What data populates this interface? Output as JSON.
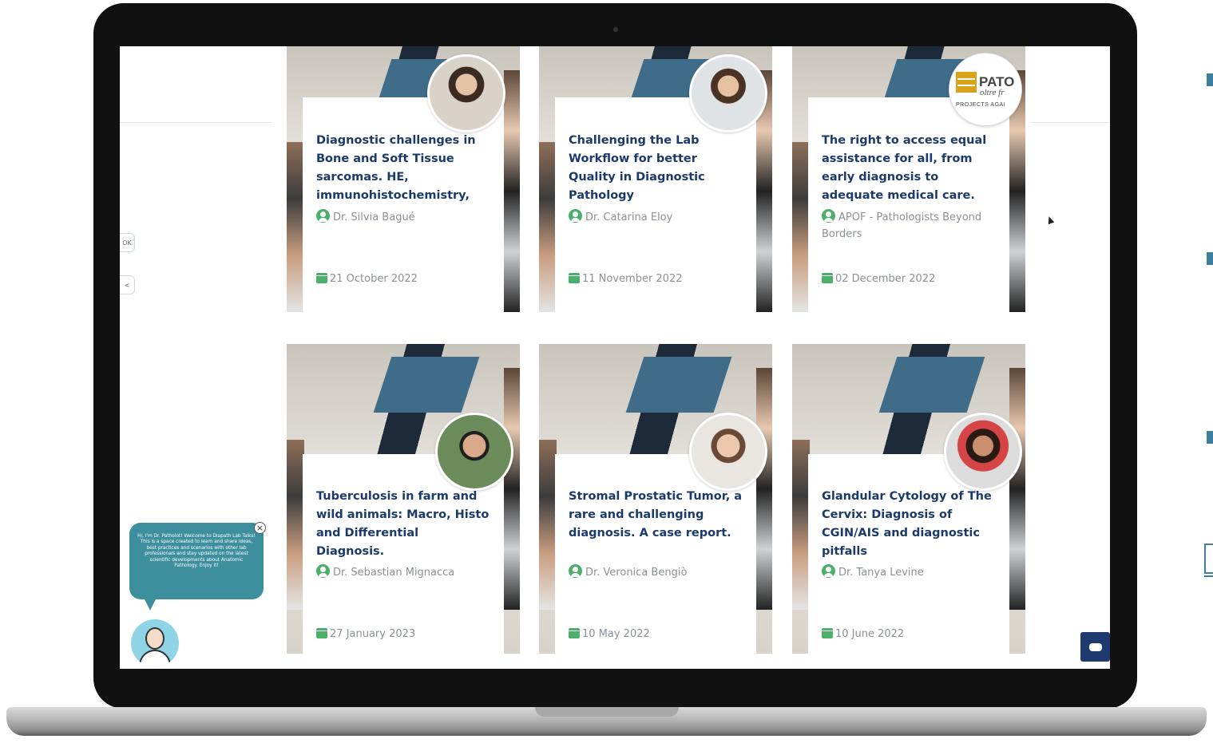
{
  "chatbot": {
    "greeting": "Hi, I'm Dr. Patholot! Welcome to Diapath Lab Talks! This is a space created to learn and share ideas, best practices and scenarios with other lab professionals and stay updated on the latest scientific developments about Anatomic Pathology. Enjoy it!",
    "close_label": "×"
  },
  "side_tabs": {
    "tab1_label": "OK",
    "tab2_label": "<"
  },
  "cards": [
    {
      "title": "Diagnostic challenges in Bone and Soft Tissue sarcomas. HE, immunohistochemistry,",
      "author": "Dr. Silvia Bagué",
      "date": "21 October 2022"
    },
    {
      "title": "Challenging the Lab Workflow for better Quality in Diagnostic Pathology",
      "author": "Dr. Catarina Eloy",
      "date": "11 November 2022"
    },
    {
      "title": "The right to access equal assistance for all, from early diagnosis to adequate medical care.",
      "author": "APOF - Pathologists Beyond Borders",
      "date": "02 December 2022"
    },
    {
      "title": "Tuberculosis in farm and wild animals: Macro, Histo and Differential Diagnosis.",
      "author": "Dr. Sebastian Mignacca",
      "date": "27 January 2023"
    },
    {
      "title": "Stromal Prostatic Tumor, a rare and challenging diagnosis. A case report.",
      "author": "Dr. Veronica Bengiò",
      "date": "10 May 2022"
    },
    {
      "title": "Glandular Cytology of The Cervix: Diagnosis of CGIN/AIS and diagnostic pitfalls",
      "author": "Dr. Tanya Levine",
      "date": "10 June 2022"
    }
  ],
  "logo": {
    "main": "PATO",
    "sub": "oltre fr",
    "tagline": "PROJECTS AGAI"
  },
  "colors": {
    "title": "#1b3a6b",
    "meta": "#8a8f99",
    "icon_green": "#4caf6a",
    "chat_teal": "#3d8f9e",
    "chat_fab": "#1f3a6e"
  }
}
